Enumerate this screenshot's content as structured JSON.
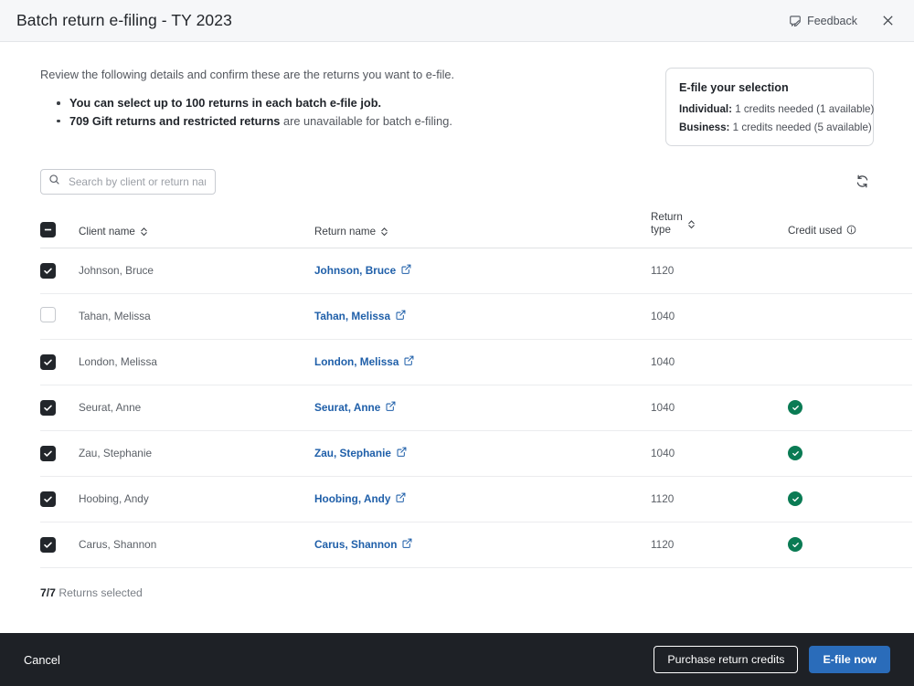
{
  "window": {
    "title": "Batch return e-filing - TY 2023",
    "feedback_label": "Feedback",
    "feedback_icon": "feedback-pencil-icon",
    "close_icon": "close-icon"
  },
  "intro": {
    "text": "Review the following details and confirm these are the returns you want to e-file.",
    "bullets": [
      {
        "bold": "You can select up to 100 returns in each batch e-file job.",
        "rest": ""
      },
      {
        "bold": "709 Gift returns and restricted returns",
        "rest": " are unavailable for batch e-filing."
      }
    ]
  },
  "info_card": {
    "title": "E-file your selection",
    "rows": [
      {
        "label": "Individual:",
        "value": "1 credits needed",
        "available": "(1 available)"
      },
      {
        "label": "Business:",
        "value": "1 credits needed",
        "available": "(5 available)"
      }
    ]
  },
  "search": {
    "placeholder": "Search by client or return name",
    "value": "",
    "icon": "search-icon"
  },
  "refresh": {
    "icon": "refresh-icon"
  },
  "table": {
    "select_all_state": "indeterminate",
    "columns": {
      "client": "Client name",
      "return": "Return name",
      "type_line1": "Return",
      "type_line2": "type",
      "credit": "Credit used"
    },
    "rows": [
      {
        "selected": true,
        "client": "Johnson, Bruce",
        "return_name": "Johnson, Bruce",
        "return_type": "1120",
        "credit_used": false
      },
      {
        "selected": false,
        "client": "Tahan, Melissa",
        "return_name": "Tahan, Melissa",
        "return_type": "1040",
        "credit_used": false
      },
      {
        "selected": true,
        "client": "London, Melissa",
        "return_name": "London, Melissa",
        "return_type": "1040",
        "credit_used": false
      },
      {
        "selected": true,
        "client": "Seurat, Anne",
        "return_name": "Seurat, Anne",
        "return_type": "1040",
        "credit_used": true
      },
      {
        "selected": true,
        "client": "Zau, Stephanie",
        "return_name": "Zau, Stephanie",
        "return_type": "1040",
        "credit_used": true
      },
      {
        "selected": true,
        "client": "Hoobing, Andy",
        "return_name": "Hoobing, Andy",
        "return_type": "1120",
        "credit_used": true
      },
      {
        "selected": true,
        "client": "Carus, Shannon",
        "return_name": "Carus, Shannon",
        "return_type": "1120",
        "credit_used": true
      }
    ]
  },
  "selection_summary": {
    "count": "7/7",
    "label": "Returns selected"
  },
  "footer": {
    "cancel_label": "Cancel",
    "purchase_label": "Purchase return credits",
    "efile_label": "E-file now"
  },
  "colors": {
    "primary_blue": "#2a6cba",
    "link_blue": "#1f5fa9",
    "success_green": "#0a7b54",
    "footer_dark": "#1e2126",
    "titlebar_bg": "#f6f7f9"
  }
}
